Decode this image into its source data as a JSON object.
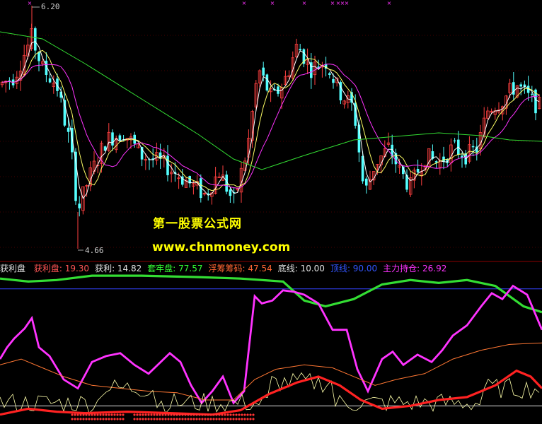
{
  "price_panel": {
    "high_label": "6.20",
    "low_label": "4.66",
    "colors": {
      "up_candle": "#ff4040",
      "down_candle": "#54ffff",
      "ma_fast": "#ffffff",
      "ma_mid": "#ffff66",
      "ma_slow": "#ff33ff",
      "ma_long": "#33dd33",
      "grid": "#8b0000"
    }
  },
  "watermark": {
    "line1": "第一股票公式网",
    "line2": "www.chnmoney.com"
  },
  "indicator": {
    "name": "获利盘",
    "fields": [
      {
        "label": "获利盘: ",
        "value": "19.30",
        "color": "#ff5555"
      },
      {
        "label": "获利: ",
        "value": "14.82",
        "color": "#e0e0e0"
      },
      {
        "label": "套牢盘: ",
        "value": "77.57",
        "color": "#33ff33"
      },
      {
        "label": "浮筹筹码: ",
        "value": "47.54",
        "color": "#ff6633"
      },
      {
        "label": "底线: ",
        "value": "10.00",
        "color": "#e0e0e0"
      },
      {
        "label": "顶线: ",
        "value": "90.00",
        "color": "#3355ff"
      },
      {
        "label": "主力持仓: ",
        "value": "26.92",
        "color": "#ff33ff"
      }
    ],
    "colors": {
      "trapped": "#33dd33",
      "topline": "#3344ff",
      "bottomline": "#ffffff",
      "profit": "#ff33ff",
      "float": "#ff7733",
      "main": "#ff2222",
      "light": "#ffffaa"
    }
  }
}
